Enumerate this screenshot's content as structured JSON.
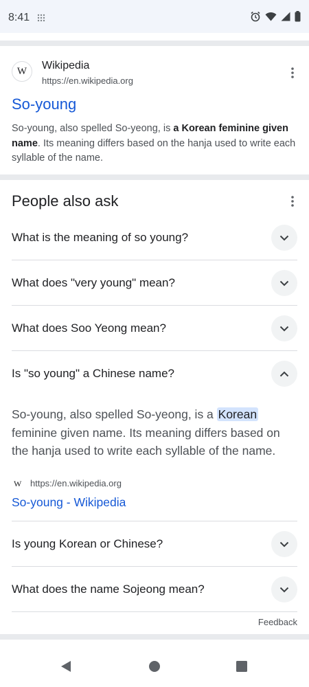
{
  "status_bar": {
    "time": "8:41"
  },
  "result": {
    "site_name": "Wikipedia",
    "site_url": "https://en.wikipedia.org",
    "logo_letter": "W",
    "title": "So-young",
    "snippet_pre": "So-young, also spelled So-yeong, is ",
    "snippet_bold": "a Korean feminine given name",
    "snippet_post": ". Its meaning differs based on the hanja used to write each syllable of the name."
  },
  "paa": {
    "heading": "People also ask",
    "questions": [
      {
        "text": "What is the meaning of so young?"
      },
      {
        "text": "What does \"very young\" mean?"
      },
      {
        "text": "What does Soo Yeong mean?"
      },
      {
        "text": "Is \"so young\" a Chinese name?"
      },
      {
        "text": "Is young Korean or Chinese?"
      },
      {
        "text": "What does the name Sojeong mean?"
      }
    ],
    "answer": {
      "text_pre": "So-young, also spelled So-yeong, is a ",
      "highlight": "Korean",
      "text_post": " feminine given name. Its meaning differs based on the hanja used to write each syllable of the name.",
      "source_logo": "W",
      "source_url": "https://en.wikipedia.org",
      "source_link": "So-young - Wikipedia"
    },
    "feedback": "Feedback"
  },
  "colors": {
    "link": "#1558d6",
    "divider": "#e8eaed",
    "status_bg": "#f2f5fb"
  }
}
